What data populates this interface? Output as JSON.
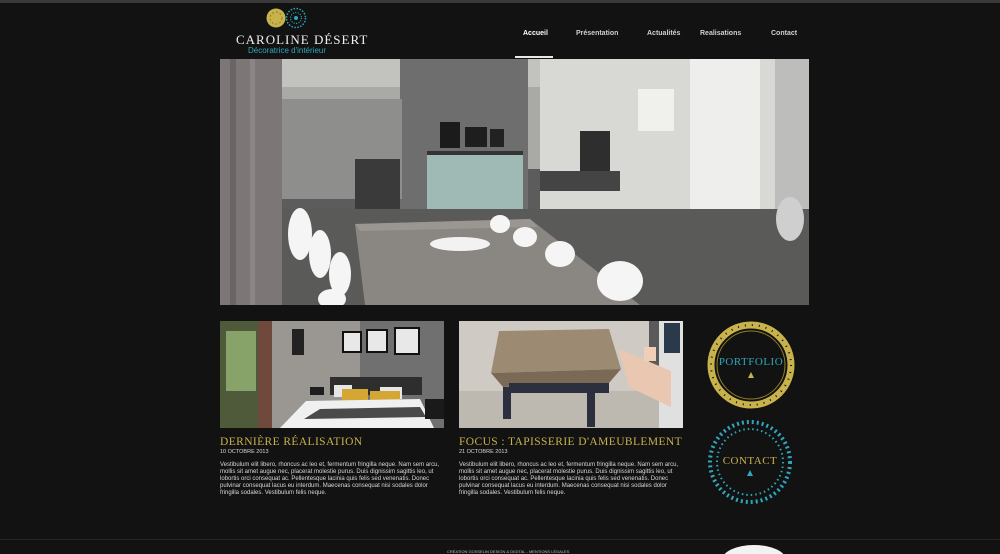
{
  "brand": {
    "name": "CAROLINE DÉSERT",
    "tagline": "Décoratrice d'intérieur",
    "colors": {
      "gold": "#c8b24b",
      "teal": "#2fa7bd",
      "background": "#121212"
    }
  },
  "nav": {
    "items": [
      {
        "label": "Accueil",
        "active": true
      },
      {
        "label": "Présentation",
        "active": false
      },
      {
        "label": "Actualités",
        "active": false
      },
      {
        "label": "Realisations",
        "active": false
      },
      {
        "label": "Contact",
        "active": false
      }
    ]
  },
  "cards": [
    {
      "title": "DERNIÈRE RÉALISATION",
      "date": "10 OCTOBRE 2013",
      "text": "Vestibulum elit libero, rhoncus ac leo et, fermentum fringilla neque. Nam sem arcu, mollis sit amet augue nec, placerat molestie purus. Duis dignissim sagittis leo, ut lobortis orci consequat ac. Pellentesque lacinia quis felis sed venenatis. Donec pulvinar consequat lacus eu interdum. Maecenas consequat nisi sodales dolor fringilla sodales. Vestibulum felis neque."
    },
    {
      "title": "FOCUS : TAPISSERIE D'AMEUBLEMENT",
      "date": "21 OCTOBRE 2013",
      "text": "Vestibulum elit libero, rhoncus ac leo et, fermentum fringilla neque. Nam sem arcu, mollis sit amet augue nec, placerat molestie purus. Duis dignissim sagittis leo, ut lobortis orci consequat ac. Pellentesque lacinia quis felis sed venenatis. Donec pulvinar consequat lacus eu interdum. Maecenas consequat nisi sodales dolor fringilla sodales. Vestibulum felis neque."
    }
  ],
  "circles": {
    "portfolio": "PORTFOLIO",
    "contact": "CONTACT"
  },
  "footer": {
    "text": "CRÉATION GOSSELIN DESIGN & DIGITAL - MENTIONS LÉGALES"
  }
}
